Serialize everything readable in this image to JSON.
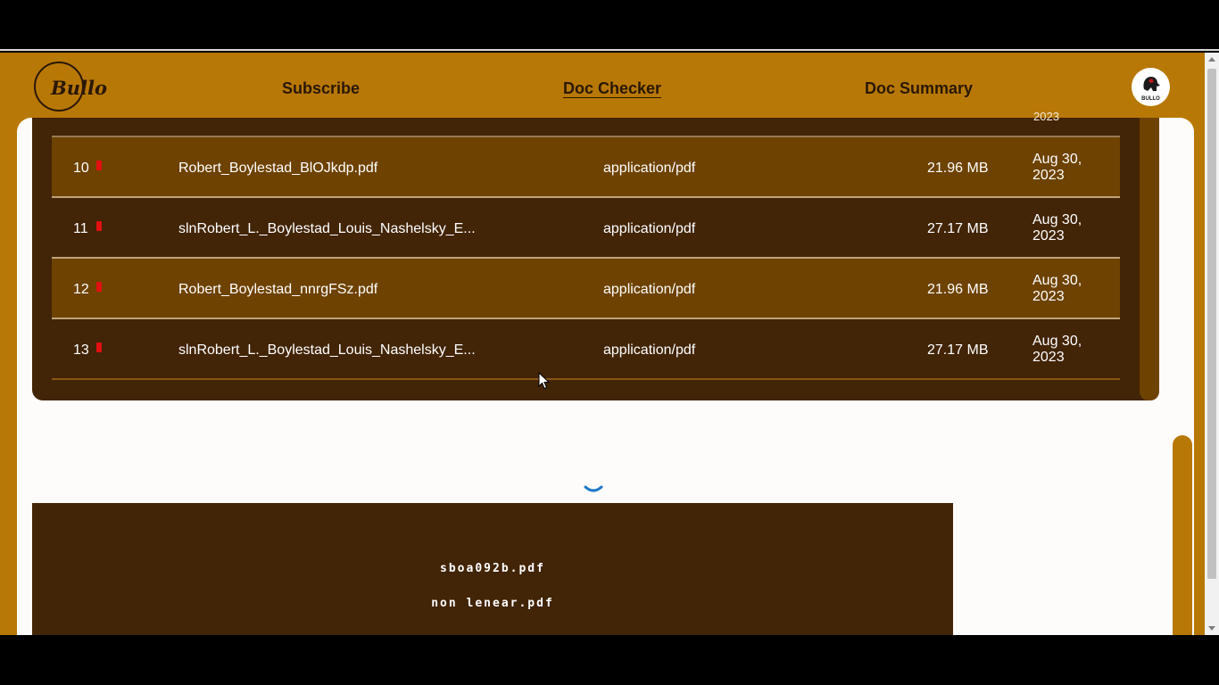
{
  "header": {
    "logo_text": "Bullo",
    "nav": {
      "subscribe": "Subscribe",
      "doc_checker": "Doc Checker",
      "doc_summary": "Doc Summary"
    },
    "avatar_label": "BULLO"
  },
  "table": {
    "clipped_date": "2023",
    "rows": [
      {
        "num": "10",
        "name": "Robert_Boylestad_BlOJkdp.pdf",
        "type": "application/pdf",
        "size": "21.96 MB",
        "date": "Aug 30, 2023"
      },
      {
        "num": "11",
        "name": "slnRobert_L._Boylestad_Louis_Nashelsky_E...",
        "type": "application/pdf",
        "size": "27.17 MB",
        "date": "Aug 30, 2023"
      },
      {
        "num": "12",
        "name": "Robert_Boylestad_nnrgFSz.pdf",
        "type": "application/pdf",
        "size": "21.96 MB",
        "date": "Aug 30, 2023"
      },
      {
        "num": "13",
        "name": "slnRobert_L._Boylestad_Louis_Nashelsky_E...",
        "type": "application/pdf",
        "size": "27.17 MB",
        "date": "Aug 30, 2023"
      }
    ]
  },
  "files": [
    "sboa092b.pdf",
    "non lenear.pdf"
  ],
  "icons": {
    "status_flag": "red-flag-icon",
    "loading": "spinner-icon",
    "cursor": "mouse-pointer-icon"
  },
  "colors": {
    "brand": "#b87806",
    "panel": "#422406",
    "row_alt": "#6e4200",
    "flag": "#e21010",
    "spinner": "#1e78c8"
  }
}
